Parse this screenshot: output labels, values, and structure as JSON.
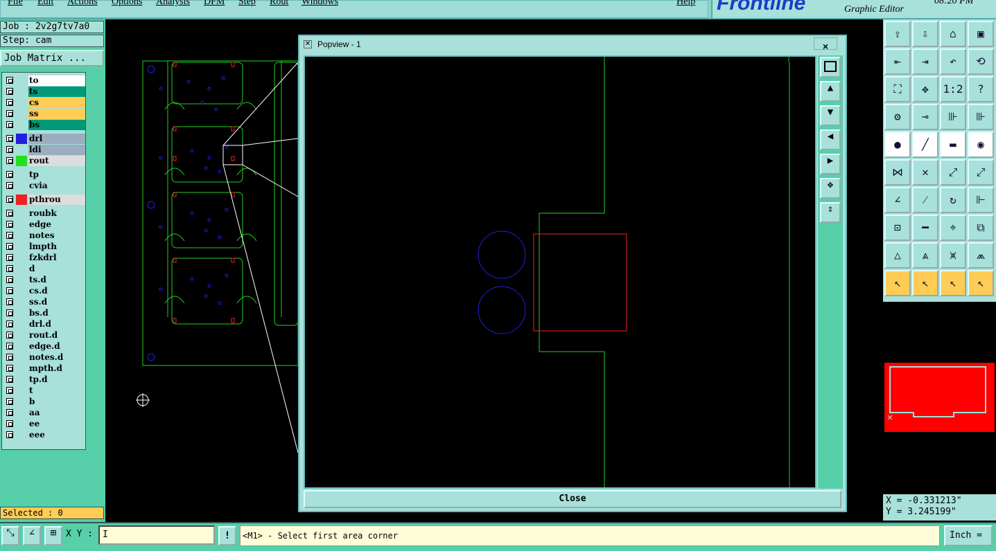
{
  "menu": {
    "items": [
      "File",
      "Edit",
      "Actions",
      "Options",
      "Analysis",
      "DFM",
      "Step",
      "Rout",
      "Windows"
    ],
    "help": "Help"
  },
  "brand": {
    "logo": "Frontline",
    "subtitle": "Graphic Editor",
    "clock": "08:20 PM"
  },
  "job": {
    "job_line": "Job : 2v2g7tv7a0",
    "step_line": "Step: cam",
    "matrix_button": "Job Matrix ..."
  },
  "layers": [
    {
      "name": "to",
      "color": "#ffffff",
      "swatch": ""
    },
    {
      "name": "ts",
      "color": "#009977",
      "swatch": ""
    },
    {
      "name": "cs",
      "color": "#ffcc55",
      "swatch": ""
    },
    {
      "name": "ss",
      "color": "#ffcc55",
      "swatch": ""
    },
    {
      "name": "bs",
      "color": "#009977",
      "swatch": ""
    },
    {
      "name": "drl",
      "color": "#9aaec0",
      "swatch": "#2020e0"
    },
    {
      "name": "ldi",
      "color": "#9aaec0",
      "swatch": ""
    },
    {
      "name": "rout",
      "color": "#dddddd",
      "swatch": "#20e020"
    },
    {
      "name": "tp",
      "color": "#a8e0da",
      "swatch": ""
    },
    {
      "name": "cvia",
      "color": "#a8e0da",
      "swatch": ""
    },
    {
      "name": "pthrou",
      "color": "#dddddd",
      "swatch": "#ee2222"
    },
    {
      "name": "roubk",
      "color": "#a8e0da",
      "swatch": ""
    },
    {
      "name": "edge",
      "color": "#a8e0da",
      "swatch": ""
    },
    {
      "name": "notes",
      "color": "#a8e0da",
      "swatch": ""
    },
    {
      "name": "lmpth",
      "color": "#a8e0da",
      "swatch": ""
    },
    {
      "name": "fzkdrl",
      "color": "#a8e0da",
      "swatch": ""
    },
    {
      "name": "d",
      "color": "#a8e0da",
      "swatch": ""
    },
    {
      "name": "ts.d",
      "color": "#a8e0da",
      "swatch": ""
    },
    {
      "name": "cs.d",
      "color": "#a8e0da",
      "swatch": ""
    },
    {
      "name": "ss.d",
      "color": "#a8e0da",
      "swatch": ""
    },
    {
      "name": "bs.d",
      "color": "#a8e0da",
      "swatch": ""
    },
    {
      "name": "drl.d",
      "color": "#a8e0da",
      "swatch": ""
    },
    {
      "name": "rout.d",
      "color": "#a8e0da",
      "swatch": ""
    },
    {
      "name": "edge.d",
      "color": "#a8e0da",
      "swatch": ""
    },
    {
      "name": "notes.d",
      "color": "#a8e0da",
      "swatch": ""
    },
    {
      "name": "mpth.d",
      "color": "#a8e0da",
      "swatch": ""
    },
    {
      "name": "tp.d",
      "color": "#a8e0da",
      "swatch": ""
    },
    {
      "name": "t",
      "color": "#a8e0da",
      "swatch": ""
    },
    {
      "name": "b",
      "color": "#a8e0da",
      "swatch": ""
    },
    {
      "name": "aa",
      "color": "#a8e0da",
      "swatch": ""
    },
    {
      "name": "ee",
      "color": "#a8e0da",
      "swatch": ""
    },
    {
      "name": "eee",
      "color": "#a8e0da",
      "swatch": ""
    }
  ],
  "selected": "Selected : 0",
  "popup": {
    "title": "Popview - 1",
    "close_x": "×",
    "close_button": "Close"
  },
  "coords": {
    "x": "X = -0.331213\"",
    "y": "Y = 3.245199\""
  },
  "bottom": {
    "xy_label": "X Y :",
    "xy_value": "I",
    "exclaim": "!",
    "prompt": "<M1> - Select first area corner",
    "units": "Inch ="
  },
  "colors": {
    "outline": "#20d020",
    "drill": "#2020e0",
    "pad": "#ee2222"
  }
}
